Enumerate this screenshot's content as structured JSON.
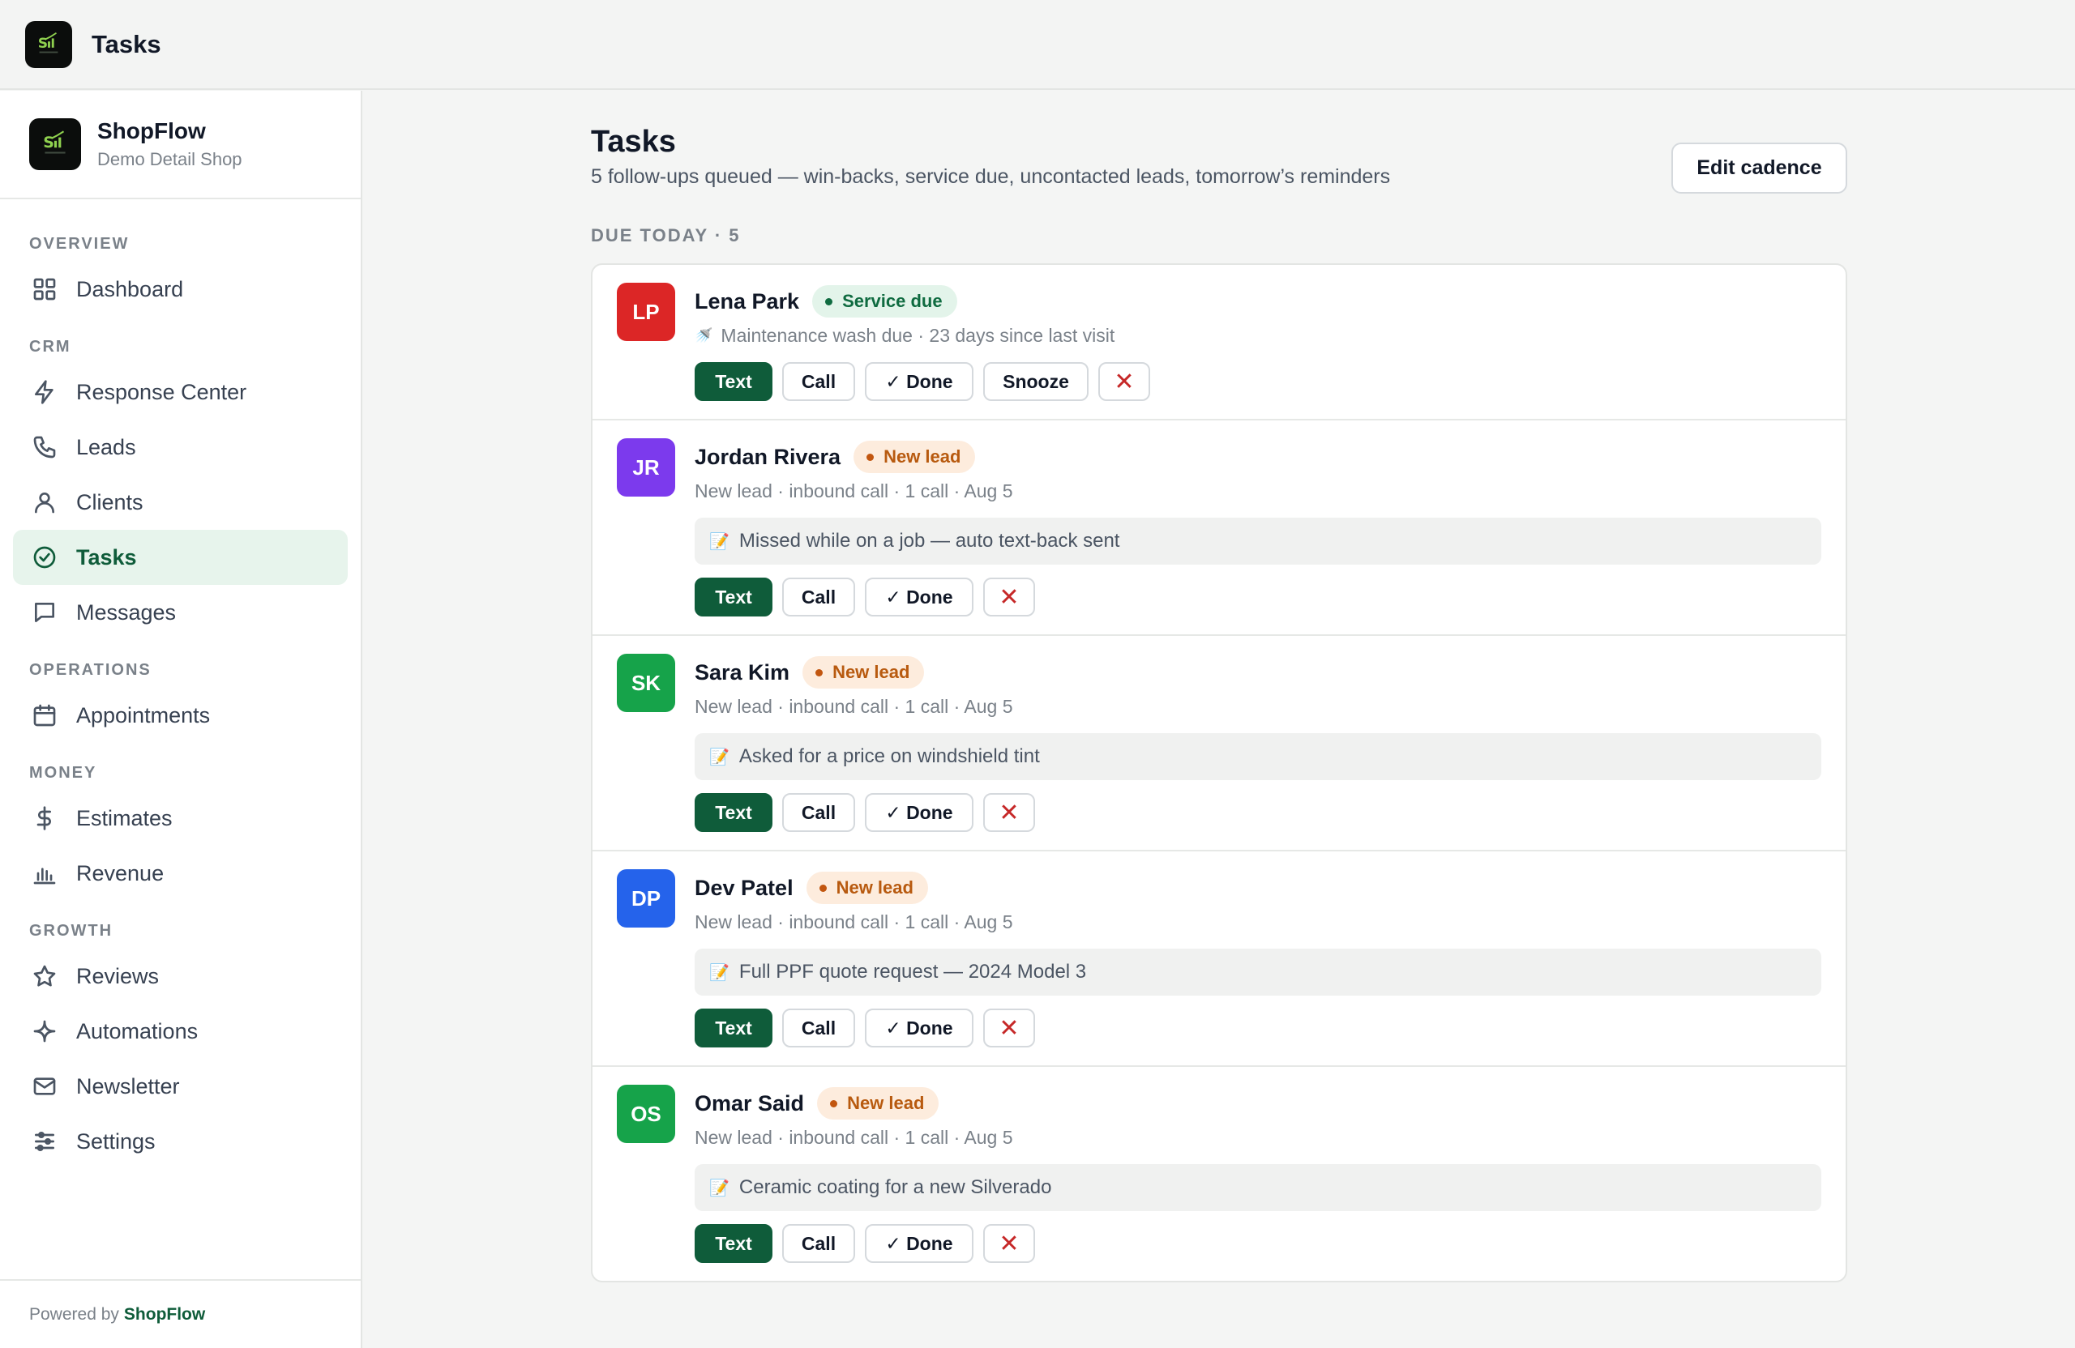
{
  "window": {
    "title": "Tasks"
  },
  "brand": {
    "name": "ShopFlow",
    "subtitle": "Demo Detail Shop"
  },
  "sidebar": {
    "sections": [
      {
        "label": "OVERVIEW",
        "items": [
          {
            "label": "Dashboard",
            "icon": "grid-icon"
          }
        ]
      },
      {
        "label": "CRM",
        "items": [
          {
            "label": "Response Center",
            "icon": "lightning-icon"
          },
          {
            "label": "Leads",
            "icon": "phone-icon"
          },
          {
            "label": "Clients",
            "icon": "person-icon"
          },
          {
            "label": "Tasks",
            "icon": "check-circle-icon",
            "active": true
          },
          {
            "label": "Messages",
            "icon": "chat-icon"
          }
        ]
      },
      {
        "label": "OPERATIONS",
        "items": [
          {
            "label": "Appointments",
            "icon": "calendar-icon"
          }
        ]
      },
      {
        "label": "MONEY",
        "items": [
          {
            "label": "Estimates",
            "icon": "dollar-icon"
          },
          {
            "label": "Revenue",
            "icon": "bar-chart-icon"
          }
        ]
      },
      {
        "label": "GROWTH",
        "items": [
          {
            "label": "Reviews",
            "icon": "star-icon"
          },
          {
            "label": "Automations",
            "icon": "sparkle-icon"
          },
          {
            "label": "Newsletter",
            "icon": "mail-icon"
          },
          {
            "label": "Settings",
            "icon": "sliders-icon"
          }
        ]
      }
    ],
    "footer": {
      "prefix": "Powered by",
      "brand": "ShopFlow"
    }
  },
  "page": {
    "title": "Tasks",
    "subtitle": "5 follow-ups queued — win-backs, service due, uncontacted leads, tomorrow’s reminders",
    "edit_button": "Edit cadence",
    "due_label": "DUE TODAY · 5"
  },
  "tasks": [
    {
      "initials": "LP",
      "color": "#dc2626",
      "name": "Lena Park",
      "badge": "Service due",
      "badge_type": "service",
      "meta": "Maintenance wash due · 23 days since last visit",
      "meta_icon": "🚿",
      "note": "",
      "actions": [
        "Text",
        "Call",
        "✓ Done",
        "Snooze",
        "✕"
      ]
    },
    {
      "initials": "JR",
      "color": "#7c3aed",
      "name": "Jordan Rivera",
      "badge": "New lead",
      "badge_type": "lead",
      "meta": "New lead · inbound call · 1 call · Aug 5",
      "meta_icon": "",
      "note": "Missed while on a job — auto text-back sent",
      "actions": [
        "Text",
        "Call",
        "✓ Done",
        "✕"
      ]
    },
    {
      "initials": "SK",
      "color": "#16a34a",
      "name": "Sara Kim",
      "badge": "New lead",
      "badge_type": "lead",
      "meta": "New lead · inbound call · 1 call · Aug 5",
      "meta_icon": "",
      "note": "Asked for a price on windshield tint",
      "actions": [
        "Text",
        "Call",
        "✓ Done",
        "✕"
      ]
    },
    {
      "initials": "DP",
      "color": "#2563eb",
      "name": "Dev Patel",
      "badge": "New lead",
      "badge_type": "lead",
      "meta": "New lead · inbound call · 1 call · Aug 5",
      "meta_icon": "",
      "note": "Full PPF quote request — 2024 Model 3",
      "actions": [
        "Text",
        "Call",
        "✓ Done",
        "✕"
      ]
    },
    {
      "initials": "OS",
      "color": "#16a34a",
      "name": "Omar Said",
      "badge": "New lead",
      "badge_type": "lead",
      "meta": "New lead · inbound call · 1 call · Aug 5",
      "meta_icon": "",
      "note": "Ceramic coating for a new Silverado",
      "actions": [
        "Text",
        "Call",
        "✓ Done",
        "✕"
      ]
    }
  ]
}
